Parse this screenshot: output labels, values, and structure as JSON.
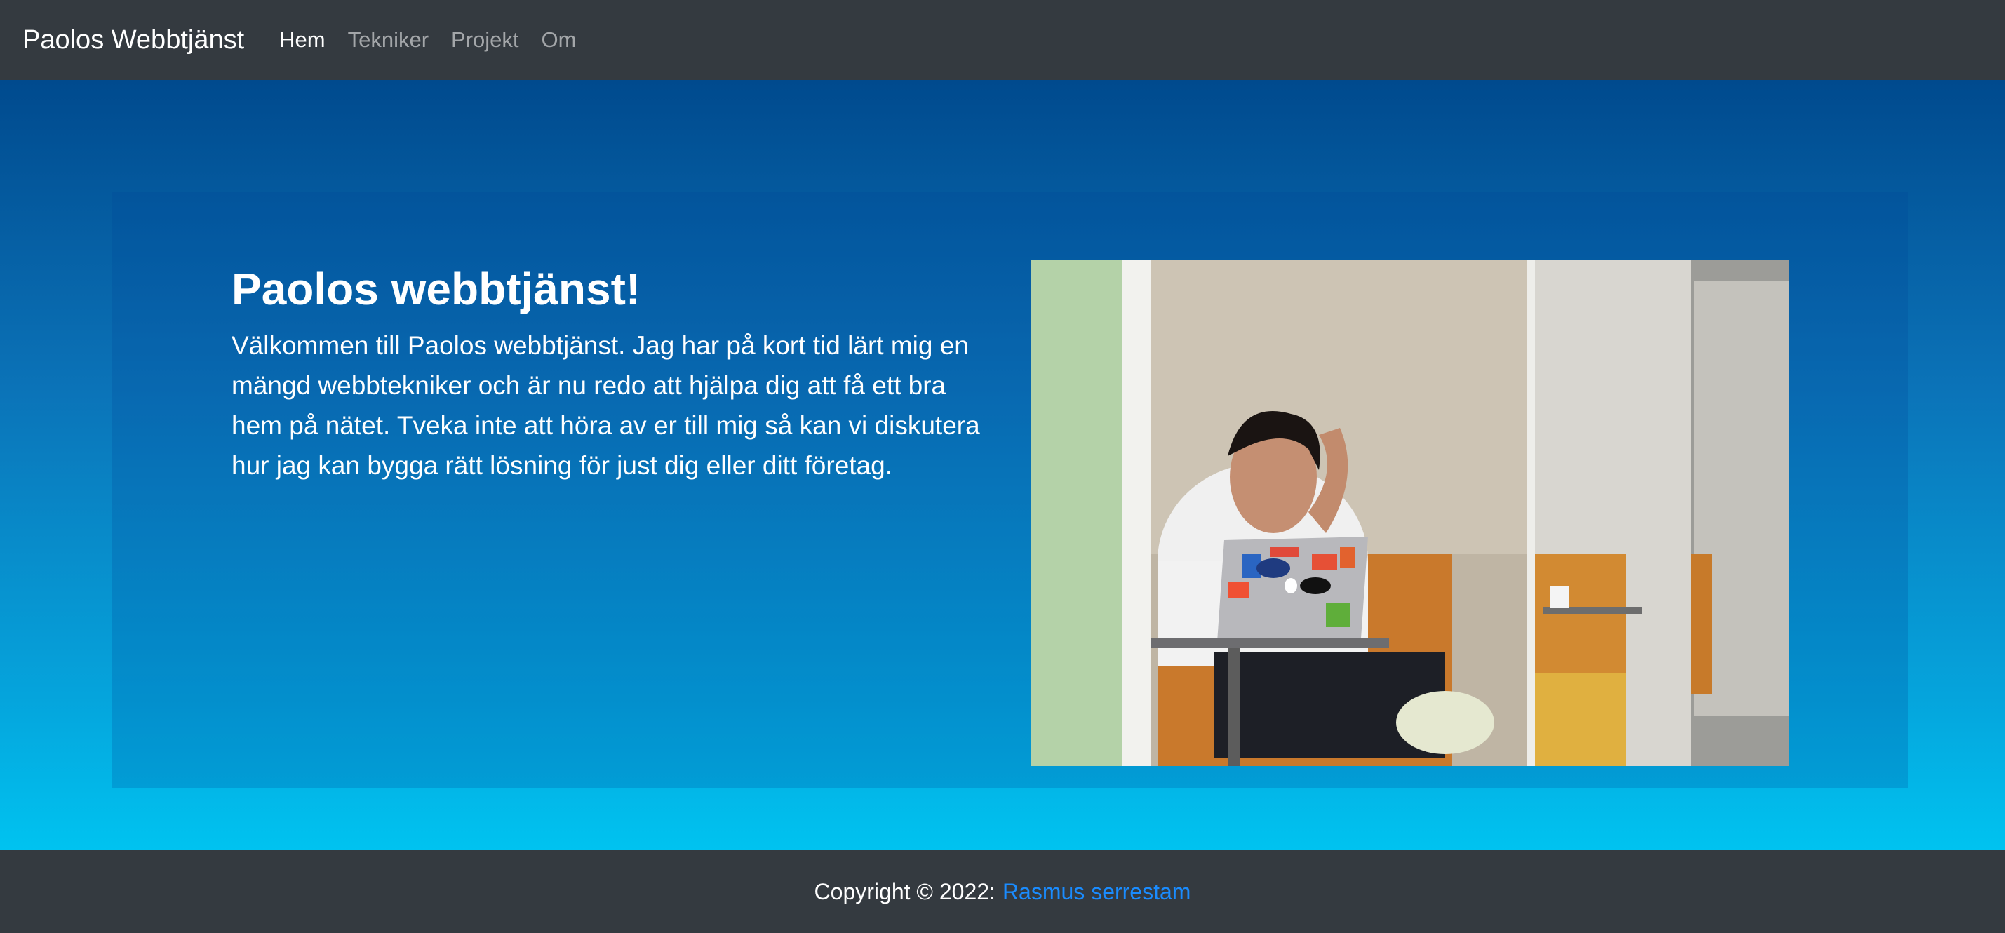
{
  "navbar": {
    "brand": "Paolos Webbtjänst",
    "links": [
      {
        "label": "Hem",
        "active": true
      },
      {
        "label": "Tekniker",
        "active": false
      },
      {
        "label": "Projekt",
        "active": false
      },
      {
        "label": "Om",
        "active": false
      }
    ]
  },
  "hero": {
    "title": "Paolos webbtjänst!",
    "text": "Välkommen till Paolos webbtjänst. Jag har på kort tid lärt mig en mängd webbtekniker och är nu redo att hjälpa dig att få ett bra hem på nätet. Tveka inte att höra av er till mig så kan vi diskutera hur jag kan bygga rätt lösning för just dig eller ditt företag."
  },
  "footer": {
    "copyright": "Copyright © 2022:",
    "author_link": "Rasmus serrestam"
  },
  "colors": {
    "navbar_bg": "#343a40",
    "hero_gradient_top": "#004a8e",
    "hero_gradient_bottom": "#00c3f0",
    "link_blue": "#1a8cff"
  }
}
